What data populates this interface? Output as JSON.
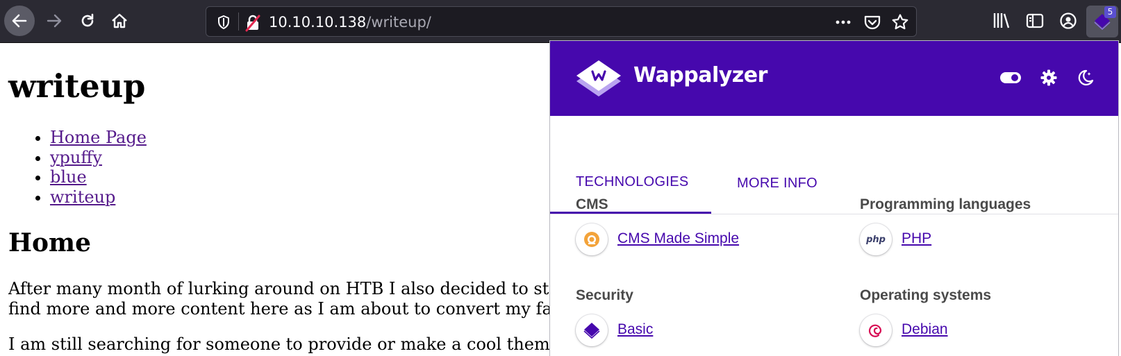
{
  "browser": {
    "url_host": "10.10.10.138",
    "url_path": "/writeup/",
    "extension_badge": "5"
  },
  "page": {
    "title": "writeup",
    "nav_links": [
      "Home Page",
      "ypuffy",
      "blue",
      "writeup"
    ],
    "section_heading": "Home",
    "paragraph1_line1": "After many month of lurking around on HTB I also decided to st",
    "paragraph1_line2": "find more and more content here as I am about to convert my fa",
    "paragraph2_line1": "I am still searching for someone to provide or make a cool them"
  },
  "wappalyzer": {
    "brand": "Wappalyzer",
    "tabs": [
      "TECHNOLOGIES",
      "MORE INFO"
    ],
    "categories": [
      {
        "title": "CMS",
        "tech": "CMS Made Simple",
        "icon": "cms-made-simple-icon"
      },
      {
        "title": "Programming languages",
        "tech": "PHP",
        "icon": "php-icon",
        "icon_text": "php"
      },
      {
        "title": "Security",
        "tech": "Basic",
        "icon": "basic-auth-icon"
      },
      {
        "title": "Operating systems",
        "tech": "Debian",
        "icon": "debian-icon"
      }
    ],
    "colors": {
      "accent": "#4608ad",
      "toolbar": "#2b2a33"
    }
  }
}
